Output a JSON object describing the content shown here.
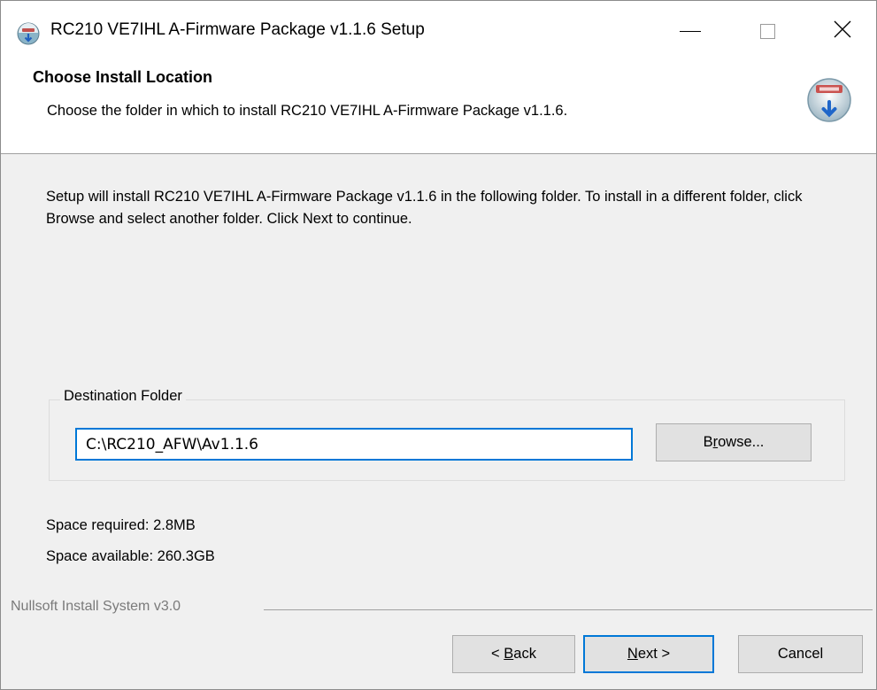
{
  "window": {
    "title": "RC210 VE7IHL A-Firmware Package v1.1.6 Setup",
    "app_icon": "installer-icon",
    "controls": {
      "minimize": "minimize-icon",
      "maximize": "maximize-icon",
      "close": "close-icon"
    }
  },
  "header": {
    "title": "Choose Install Location",
    "subtitle": "Choose the folder in which to install RC210 VE7IHL A-Firmware Package v1.1.6.",
    "icon": "nsis-install-icon"
  },
  "body": {
    "intro": "Setup will install RC210 VE7IHL A-Firmware Package v1.1.6 in the following folder. To install in a different folder, click Browse and select another folder. Click Next to continue.",
    "destination": {
      "legend": "Destination Folder",
      "path": "C:\\RC210_AFW\\Av1.1.6",
      "browse_pre": "B",
      "browse_underline": "r",
      "browse_post": "owse..."
    },
    "space_required": "Space required: 2.8MB",
    "space_available": "Space available: 260.3GB"
  },
  "footer": {
    "branding": "Nullsoft Install System v3.0",
    "back_pre": "< ",
    "back_underline": "B",
    "back_post": "ack",
    "next_underline": "N",
    "next_post": "ext >",
    "cancel": "Cancel"
  },
  "colors": {
    "accent": "#0078d7",
    "button_face": "#e1e1e1",
    "background": "#f0f0f0"
  }
}
